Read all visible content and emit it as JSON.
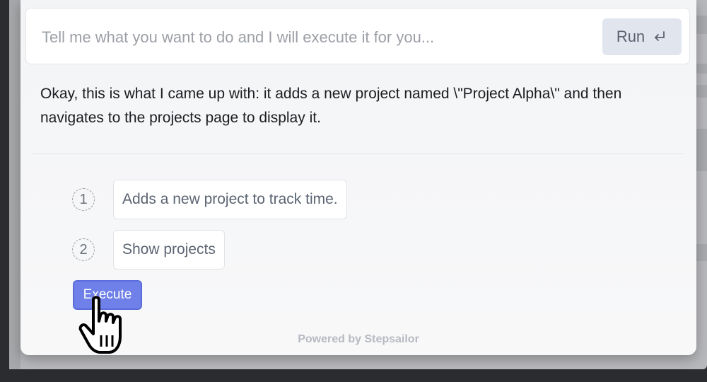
{
  "search": {
    "placeholder": "Tell me what you want to do and I will execute it for you...",
    "value": ""
  },
  "run_button": {
    "label": "Run",
    "icon": "enter-return-icon"
  },
  "response": {
    "text": "Okay, this is what I came up with: it adds a new project named \\\"Project Alpha\\\" and then navigates to the projects page to display it."
  },
  "steps": [
    {
      "number": "1",
      "label": "Adds a new project to track time."
    },
    {
      "number": "2",
      "label": "Show projects"
    }
  ],
  "execute_button": {
    "label": "Execute"
  },
  "footer": {
    "text": "Powered by Stepsailor"
  },
  "cursor": {
    "icon": "hand-pointer-icon"
  },
  "colors": {
    "accent": "#6f80e8",
    "panel_bg": "#f5f6f8",
    "run_bg": "#e1e6ee",
    "footer_text": "#b6bac1"
  }
}
